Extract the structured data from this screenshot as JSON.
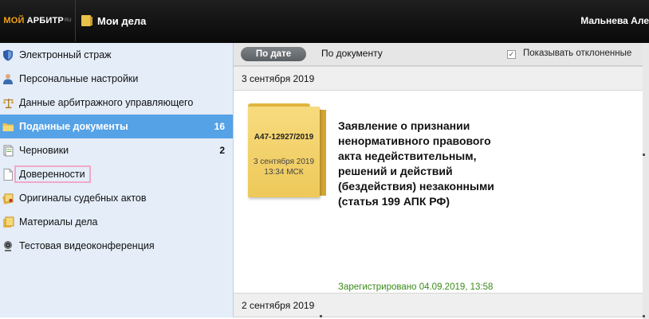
{
  "header": {
    "logo_part1": "МОЙ",
    "logo_part2": "АРБИТР",
    "logo_sup": "RU",
    "my_affairs": "Мои дела",
    "user_name": "Мальнева Але"
  },
  "sidebar": {
    "items": [
      {
        "label": "Электронный страж",
        "icon": "shield-icon",
        "count": ""
      },
      {
        "label": "Персональные настройки",
        "icon": "person-icon",
        "count": ""
      },
      {
        "label": "Данные арбитражного управляющего",
        "icon": "scales-icon",
        "count": ""
      },
      {
        "label": "Поданные документы",
        "icon": "folder-icon",
        "count": "16"
      },
      {
        "label": "Черновики",
        "icon": "draft-icon",
        "count": "2"
      },
      {
        "label": "Доверенности",
        "icon": "document-icon",
        "count": ""
      },
      {
        "label": "Оригиналы судебных актов",
        "icon": "originals-icon",
        "count": ""
      },
      {
        "label": "Материалы дела",
        "icon": "case-materials-icon",
        "count": ""
      },
      {
        "label": "Тестовая видеоконференция",
        "icon": "webcam-icon",
        "count": ""
      }
    ]
  },
  "filters": {
    "by_date": "По дате",
    "by_document": "По документу",
    "show_rejected": "Показывать отклоненные",
    "show_rejected_checked": true
  },
  "groups": [
    {
      "date": "3 сентября 2019",
      "doc": {
        "case_number": "А47-12927/2019",
        "filed_date": "3 сентября 2019",
        "filed_time": "13:34 МСК",
        "title": "Заявление о признании ненормативного правового акта недействительным, решений и действий (бездействия) незаконными (статья 199 АПК РФ)",
        "status": "Зарегистрировано 04.09.2019, 13:58"
      }
    },
    {
      "date": "2 сентября 2019"
    }
  ],
  "colors": {
    "active_item": "#55a2e6",
    "sidebar_bg": "#e4edf8",
    "status_green": "#3a8a1a",
    "folder_yellow": "#f2cf66",
    "highlight_border": "#f2a8c8"
  }
}
